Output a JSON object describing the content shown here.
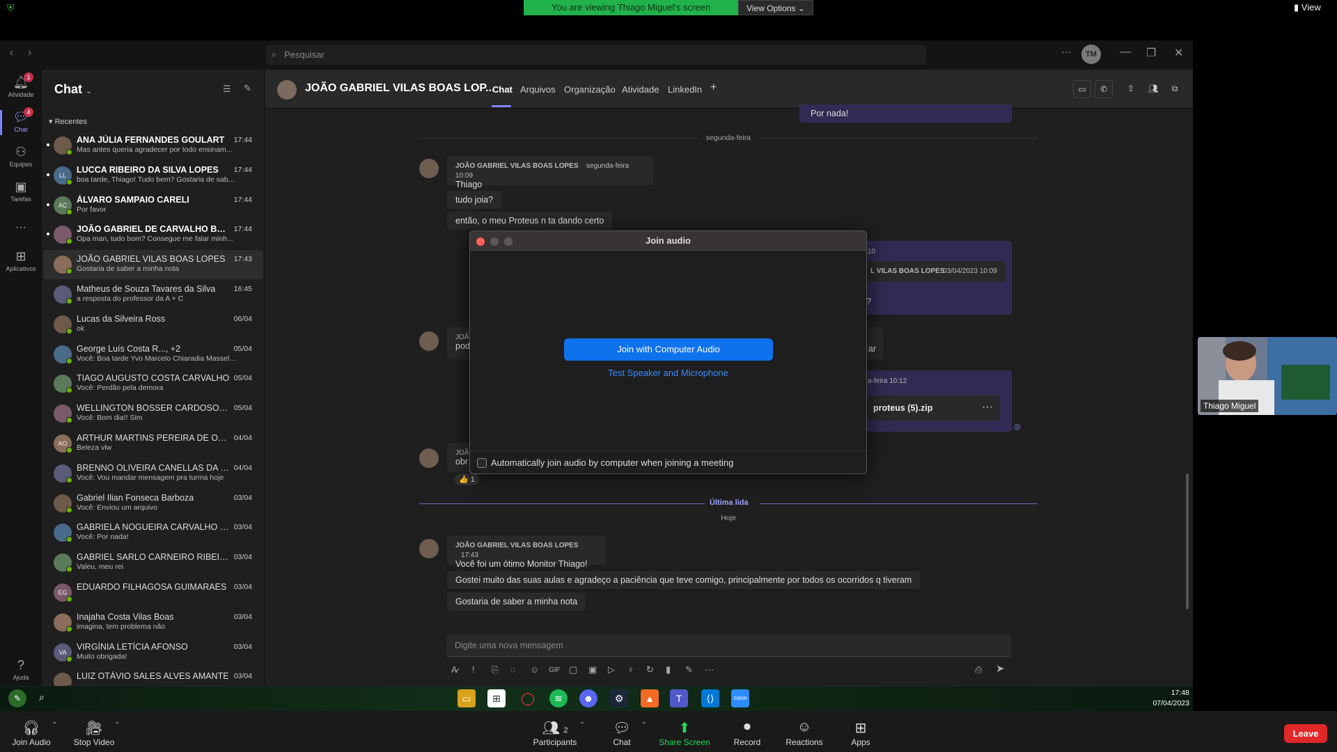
{
  "zoom": {
    "banner": "You are viewing Thiago Miguel's screen",
    "view_options": "View Options",
    "view": "View",
    "leave": "Leave",
    "toolbar": [
      {
        "label": "Join Audio",
        "icon": "headphone-icon"
      },
      {
        "label": "Stop Video",
        "icon": "video-camera-icon"
      },
      {
        "label": "Participants",
        "count": "2",
        "icon": "participants-icon"
      },
      {
        "label": "Chat",
        "icon": "chat-icon"
      },
      {
        "label": "Share Screen",
        "icon": "share-screen-icon"
      },
      {
        "label": "Record",
        "icon": "record-icon"
      },
      {
        "label": "Reactions",
        "icon": "reactions-icon"
      },
      {
        "label": "Apps",
        "icon": "apps-icon"
      }
    ],
    "video_name": "Thiago Miguel"
  },
  "teams": {
    "search_placeholder": "Pesquisar",
    "avatar_initials": "TM",
    "rail": [
      {
        "label": "Atividade",
        "badge": "1"
      },
      {
        "label": "Chat",
        "badge": "4"
      },
      {
        "label": "Equipes"
      },
      {
        "label": "Tarefas"
      },
      {
        "label": "Aplicativos"
      },
      {
        "label": "Ajuda"
      }
    ],
    "sidebar": {
      "title": "Chat",
      "section": "Recentes",
      "chats": [
        {
          "name": "ANA JÚLIA FERNANDES GOULART",
          "msg": "Mas antes queria agradecer por todo ensinam...",
          "time": "17:44",
          "unread": true
        },
        {
          "name": "LUCCA RIBEIRO DA SILVA LOPES",
          "msg": "boa tarde, Thiago! Tudo bem? Gostaria de sab...",
          "time": "17:44",
          "unread": true,
          "initials": "LL"
        },
        {
          "name": "ÁLVARO SAMPAIO CARELI",
          "msg": "Por favor",
          "time": "17:44",
          "unread": true,
          "initials": "AC"
        },
        {
          "name": "JOÃO GABRIEL DE CARVALHO BAR...",
          "msg": "Opa man, tudo bom? Consegue me falar minh...",
          "time": "17:44",
          "unread": true
        },
        {
          "name": "JOÃO GABRIEL VILAS BOAS LOPES",
          "msg": "Gostaria de saber a minha nota",
          "time": "17:43",
          "active": true
        },
        {
          "name": "Matheus de Souza Tavares da Silva",
          "msg": "a resposta do professor da A + C",
          "time": "16:45"
        },
        {
          "name": "Lucas da Silveira Ross",
          "msg": "ok",
          "time": "06/04"
        },
        {
          "name": "George Luís Costa R..., +2",
          "msg": "Você: Boa tarde Yvo Marcelo Chiaradia Masselli ...",
          "time": "05/04"
        },
        {
          "name": "TIAGO AUGUSTO COSTA CARVALHO",
          "msg": "Você: Perdão pela demora",
          "time": "05/04"
        },
        {
          "name": "WELLINGTON BOSSER CARDOSO JUN...",
          "msg": "Você: Bom dia!! Sim",
          "time": "05/04"
        },
        {
          "name": "ARTHUR MARTINS PEREIRA DE OLIVEI...",
          "msg": "Beleza vlw",
          "time": "04/04",
          "initials": "AO"
        },
        {
          "name": "BRENNO OLIVEIRA CANELLAS DA CO...",
          "msg": "Você: Vou mandar mensagem pra turma hoje",
          "time": "04/04"
        },
        {
          "name": "Gabriel Ilian Fonseca Barboza",
          "msg": "Você: Enviou um arquivo",
          "time": "03/04"
        },
        {
          "name": "GABRIELA NOGUEIRA CARVALHO FER...",
          "msg": "Você: Por nada!",
          "time": "03/04"
        },
        {
          "name": "GABRIEL SARLO CARNEIRO RIBEIRO",
          "msg": "Valeu, meu rei",
          "time": "03/04"
        },
        {
          "name": "EDUARDO FILHAGOSA GUIMARAES",
          "msg": "",
          "time": "03/04",
          "initials": "EG"
        },
        {
          "name": "Inajaha Costa Vilas Boas",
          "msg": "imagina, tem problema não",
          "time": "03/04"
        },
        {
          "name": "VIRGÍNIA LETÍCIA AFONSO",
          "msg": "Muito obrigada!",
          "time": "03/04",
          "initials": "VA"
        },
        {
          "name": "LUIZ OTÁVIO SALES ALVES AMANTE",
          "msg": "",
          "time": "03/04"
        }
      ]
    },
    "header": {
      "title": "JOÃO GABRIEL VILAS BOAS LOP...",
      "tabs": [
        "Chat",
        "Arquivos",
        "Organização",
        "Atividade",
        "LinkedIn"
      ]
    },
    "conversation": {
      "top_own": "Por nada!",
      "sep1": "segunda-feira",
      "m1_author": "JOÃO GABRIEL VILAS BOAS LOPES",
      "m1_time": "segunda-feira 10:09",
      "m1_lines": [
        "Thiago",
        "tudo joia?",
        "então, o meu Proteus n ta dando certo"
      ],
      "own_frag_time": "10",
      "own_frag_author": "L VILAS BOAS LOPES",
      "own_frag_date": "03/04/2023 10:09",
      "own_frag_q": "?",
      "m2_frag_name": "JOÃ",
      "m2_frag_text": "pod",
      "m2_frag_end": "ar",
      "file_frag_time": "a-feira 10:12",
      "file_name": "proteus (5).zip",
      "m3_frag_name": "JOÃ",
      "m3_frag_text": "obr",
      "reaction": "👍 1",
      "ultima_lida": "Última lida",
      "sep2": "Hoje",
      "m4_author": "JOÃO GABRIEL VILAS BOAS LOPES",
      "m4_time": "17:43",
      "m4_lines": [
        "Você foi um ótimo Monitor Thiago!",
        "Gostei muito das suas aulas e agradeço a paciência que teve comigo, principalmente por todos os ocorridos q tiveram",
        "Gostaria de saber a minha nota"
      ],
      "composer_placeholder": "Digite uma nova mensagem"
    }
  },
  "dialog": {
    "title": "Join audio",
    "join_btn": "Join with Computer Audio",
    "test_link": "Test Speaker and Microphone",
    "auto_label": "Automatically join audio by computer when joining a meeting"
  },
  "taskbar": {
    "time": "17:48",
    "date": "07/04/2023"
  }
}
